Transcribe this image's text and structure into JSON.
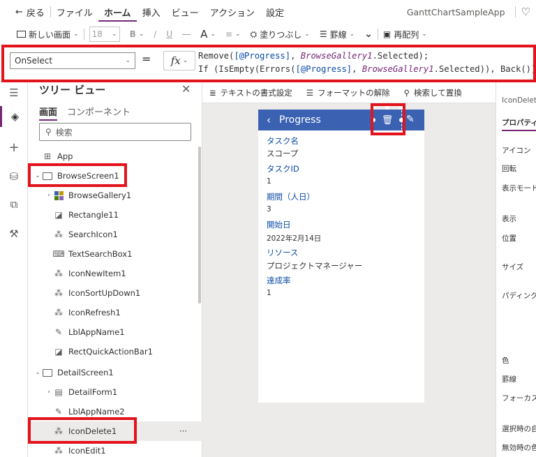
{
  "menubar": {
    "back": "戻る",
    "file": "ファイル",
    "home": "ホーム",
    "insert": "挿入",
    "view": "ビュー",
    "action": "アクション",
    "settings": "設定",
    "app_name": "GanttChartSampleApp"
  },
  "ribbon": {
    "new_screen": "新しい画面",
    "font_size": "18",
    "bold": "B",
    "italic": "/",
    "underline": "U",
    "strike": "—",
    "font_color": "A",
    "fill": "塗りつぶし",
    "border": "罫線",
    "reorder": "再配列"
  },
  "formula": {
    "property": "OnSelect",
    "equals": "=",
    "fx": "fx",
    "line1_fn": "Remove(",
    "line1_src": "[@Progress]",
    "line1_sep": ", ",
    "line1_sel": "BrowseGallery1",
    "line1_end": ".Selected);",
    "line2_if": "If",
    "line2_a": " (IsEmpty(Errors(",
    "line2_src": "[@Progress]",
    "line2_sep": ", ",
    "line2_sel": "BrowseGallery1",
    "line2_b": ".Selected)), ",
    "line2_back": "Back",
    "line2_end": "())"
  },
  "tree": {
    "title": "ツリー ビュー",
    "tab_screens": "画面",
    "tab_components": "コンポーネント",
    "search_placeholder": "検索",
    "app": "App",
    "items": [
      {
        "label": "BrowseScreen1"
      },
      {
        "label": "BrowseGallery1"
      },
      {
        "label": "Rectangle11"
      },
      {
        "label": "SearchIcon1"
      },
      {
        "label": "TextSearchBox1"
      },
      {
        "label": "IconNewItem1"
      },
      {
        "label": "IconSortUpDown1"
      },
      {
        "label": "IconRefresh1"
      },
      {
        "label": "LblAppName1"
      },
      {
        "label": "RectQuickActionBar1"
      },
      {
        "label": "DetailScreen1"
      },
      {
        "label": "DetailForm1"
      },
      {
        "label": "LblAppName2"
      },
      {
        "label": "IconDelete1"
      },
      {
        "label": "IconEdit1"
      }
    ],
    "more": "···"
  },
  "canvas_toolbar": {
    "text_format": "テキストの書式設定",
    "clear_format": "フォーマットの解除",
    "find_replace": "検索して置換"
  },
  "screen": {
    "title": "Progress",
    "fields": [
      {
        "label": "タスク名",
        "value": "スコープ"
      },
      {
        "label": "タスクID",
        "value": "1"
      },
      {
        "label": "期間（人日）",
        "value": "3"
      },
      {
        "label": "開始日",
        "value": "2022年2月14日"
      },
      {
        "label": "リソース",
        "value": "プロジェクトマネージャー"
      },
      {
        "label": "達成率",
        "value": "1"
      }
    ]
  },
  "props": {
    "control_name": "IconDelet",
    "tab": "プロパティ",
    "icon": "アイコン",
    "rotation": "回転",
    "display_mode": "表示モード",
    "visible": "表示",
    "position": "位置",
    "size": "サイズ",
    "padding": "パディング",
    "color": "色",
    "border": "罫線",
    "focus": "フォーカスがあ",
    "selected": "選択時の自",
    "disabled": "無効時の色"
  },
  "colors": {
    "accent": "#742774",
    "header_blue": "#3b62b2",
    "annotation_red": "#e3131c"
  }
}
